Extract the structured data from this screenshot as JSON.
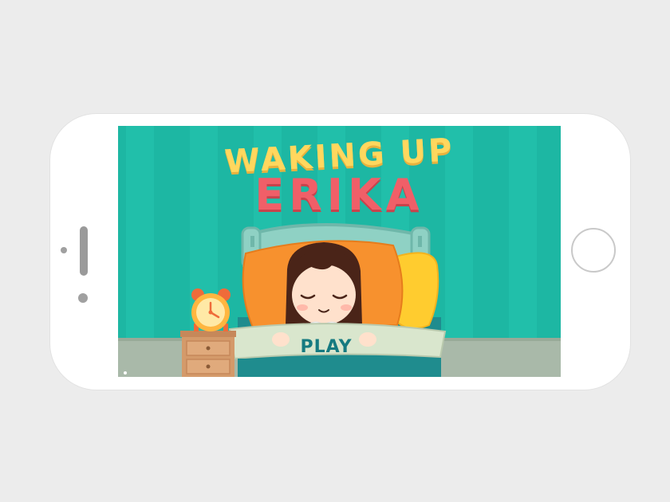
{
  "game": {
    "title_line1": "WAKING UP",
    "title_line2": "ERIKA",
    "play_label": "PLAY"
  },
  "icons": [
    "alarm-clock-icon",
    "home-button-icon"
  ],
  "colors": {
    "wall": "#1db7a3",
    "wall_stripe": "#22c0ac",
    "floor": "#a9b9a9",
    "title_yellow": "#ffd75e",
    "title_red": "#f05f68",
    "pillow_orange": "#f7912e",
    "pillow_yellow": "#ffcc2f",
    "blanket": "#d9e6cd",
    "play_text": "#157a80"
  }
}
